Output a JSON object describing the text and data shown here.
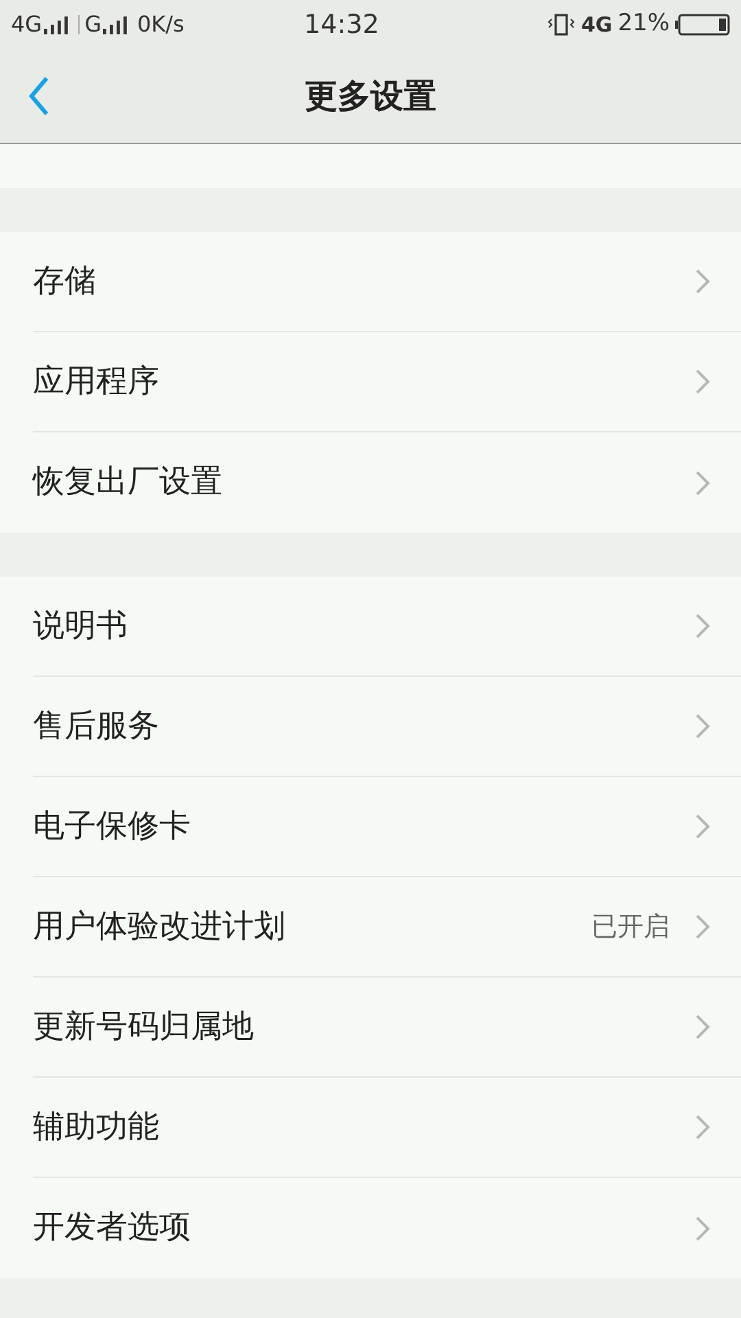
{
  "status_bar": {
    "sim1": "4G",
    "sim2": "G",
    "speed": "0K/s",
    "time": "14:32",
    "network": "4G",
    "battery": "21%"
  },
  "header": {
    "title": "更多设置"
  },
  "groups": [
    {
      "items": [
        {
          "label": "存储"
        },
        {
          "label": "应用程序"
        },
        {
          "label": "恢复出厂设置"
        }
      ]
    },
    {
      "items": [
        {
          "label": "说明书"
        },
        {
          "label": "售后服务"
        },
        {
          "label": "电子保修卡"
        },
        {
          "label": "用户体验改进计划",
          "value": "已开启"
        },
        {
          "label": "更新号码归属地"
        },
        {
          "label": "辅助功能"
        },
        {
          "label": "开发者选项"
        }
      ]
    }
  ]
}
